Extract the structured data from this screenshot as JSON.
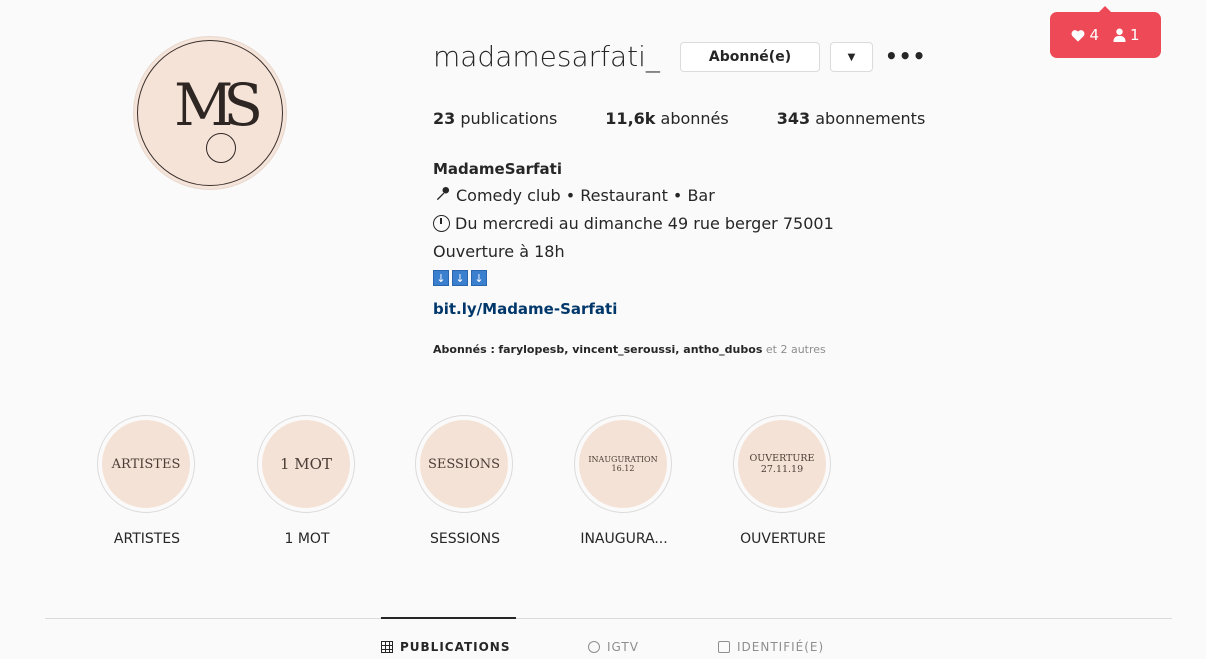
{
  "profile": {
    "username": "madamesarfati_",
    "follow_label": "Abonné(e)",
    "dropdown_glyph": "▼",
    "more_glyph": "•••",
    "avatar_monogram": "MS",
    "stats": {
      "posts_count": "23",
      "posts_label": "publications",
      "followers_count": "11,6k",
      "followers_label": "abonnés",
      "following_count": "343",
      "following_label": "abonnements"
    },
    "bio": {
      "name": "MadameSarfati",
      "line1": "Comedy club • Restaurant • Bar",
      "line1_icon": "microphone-icon",
      "line2": "Du mercredi au dimanche 49 rue berger 75001",
      "line2_icon": "clock-icon",
      "line3": "Ouverture à 18h",
      "arrows": [
        "↓",
        "↓",
        "↓"
      ],
      "link": "bit.ly/Madame-Sarfati"
    },
    "followed_by": {
      "prefix": "Abonnés :",
      "names": "farylopesb, vincent_seroussi, antho_dubos",
      "suffix": "et 2 autres"
    }
  },
  "notification": {
    "likes": "4",
    "follows": "1",
    "color": "#ed4956"
  },
  "highlights": [
    {
      "cover_line1": "ARTISTES",
      "cover_line2": "",
      "label": "ARTISTES"
    },
    {
      "cover_line1": "1 MOT",
      "cover_line2": "",
      "label": "1 MOT"
    },
    {
      "cover_line1": "SESSIONS",
      "cover_line2": "",
      "label": "SESSIONS"
    },
    {
      "cover_line1": "INAUGURATION",
      "cover_line2": "16.12",
      "label": "INAUGURA..."
    },
    {
      "cover_line1": "OUVERTURE",
      "cover_line2": "27.11.19",
      "label": "OUVERTURE"
    }
  ],
  "tabs": [
    {
      "label": "PUBLICATIONS",
      "icon": "grid-icon",
      "active": true
    },
    {
      "label": "IGTV",
      "icon": "igtv-icon",
      "active": false
    },
    {
      "label": "IDENTIFIÉ(E)",
      "icon": "tagged-icon",
      "active": false
    }
  ]
}
